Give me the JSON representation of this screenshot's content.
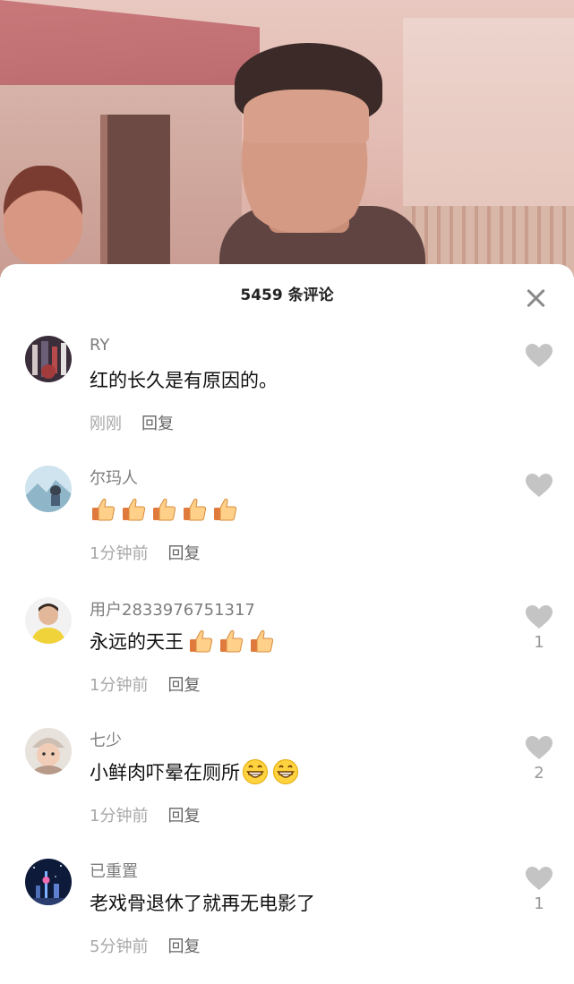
{
  "sheet": {
    "title": "5459 条评论"
  },
  "comments": [
    {
      "username": "RY",
      "text": "红的长久是有原因的。",
      "time": "刚刚",
      "reply": "回复",
      "likes": "",
      "emoji": []
    },
    {
      "username": "尔玛人",
      "text": "",
      "time": "1分钟前",
      "reply": "回复",
      "likes": "",
      "emoji": [
        "thumbs-up",
        "thumbs-up",
        "thumbs-up",
        "thumbs-up",
        "thumbs-up"
      ]
    },
    {
      "username": "用户2833976751317",
      "text": "永远的天王",
      "time": "1分钟前",
      "reply": "回复",
      "likes": "1",
      "emoji": [
        "thumbs-up",
        "thumbs-up",
        "thumbs-up"
      ]
    },
    {
      "username": "七少",
      "text": "小鲜肉吓晕在厕所",
      "time": "1分钟前",
      "reply": "回复",
      "likes": "2",
      "emoji": [
        "grin",
        "grin"
      ]
    },
    {
      "username": "已重置",
      "text": "老戏骨退休了就再无电影了",
      "time": "5分钟前",
      "reply": "回复",
      "likes": "1",
      "emoji": []
    }
  ],
  "colors": {
    "heart": "#c4c4c4",
    "username": "#7d7d7d",
    "meta": "#a8a8a8"
  }
}
